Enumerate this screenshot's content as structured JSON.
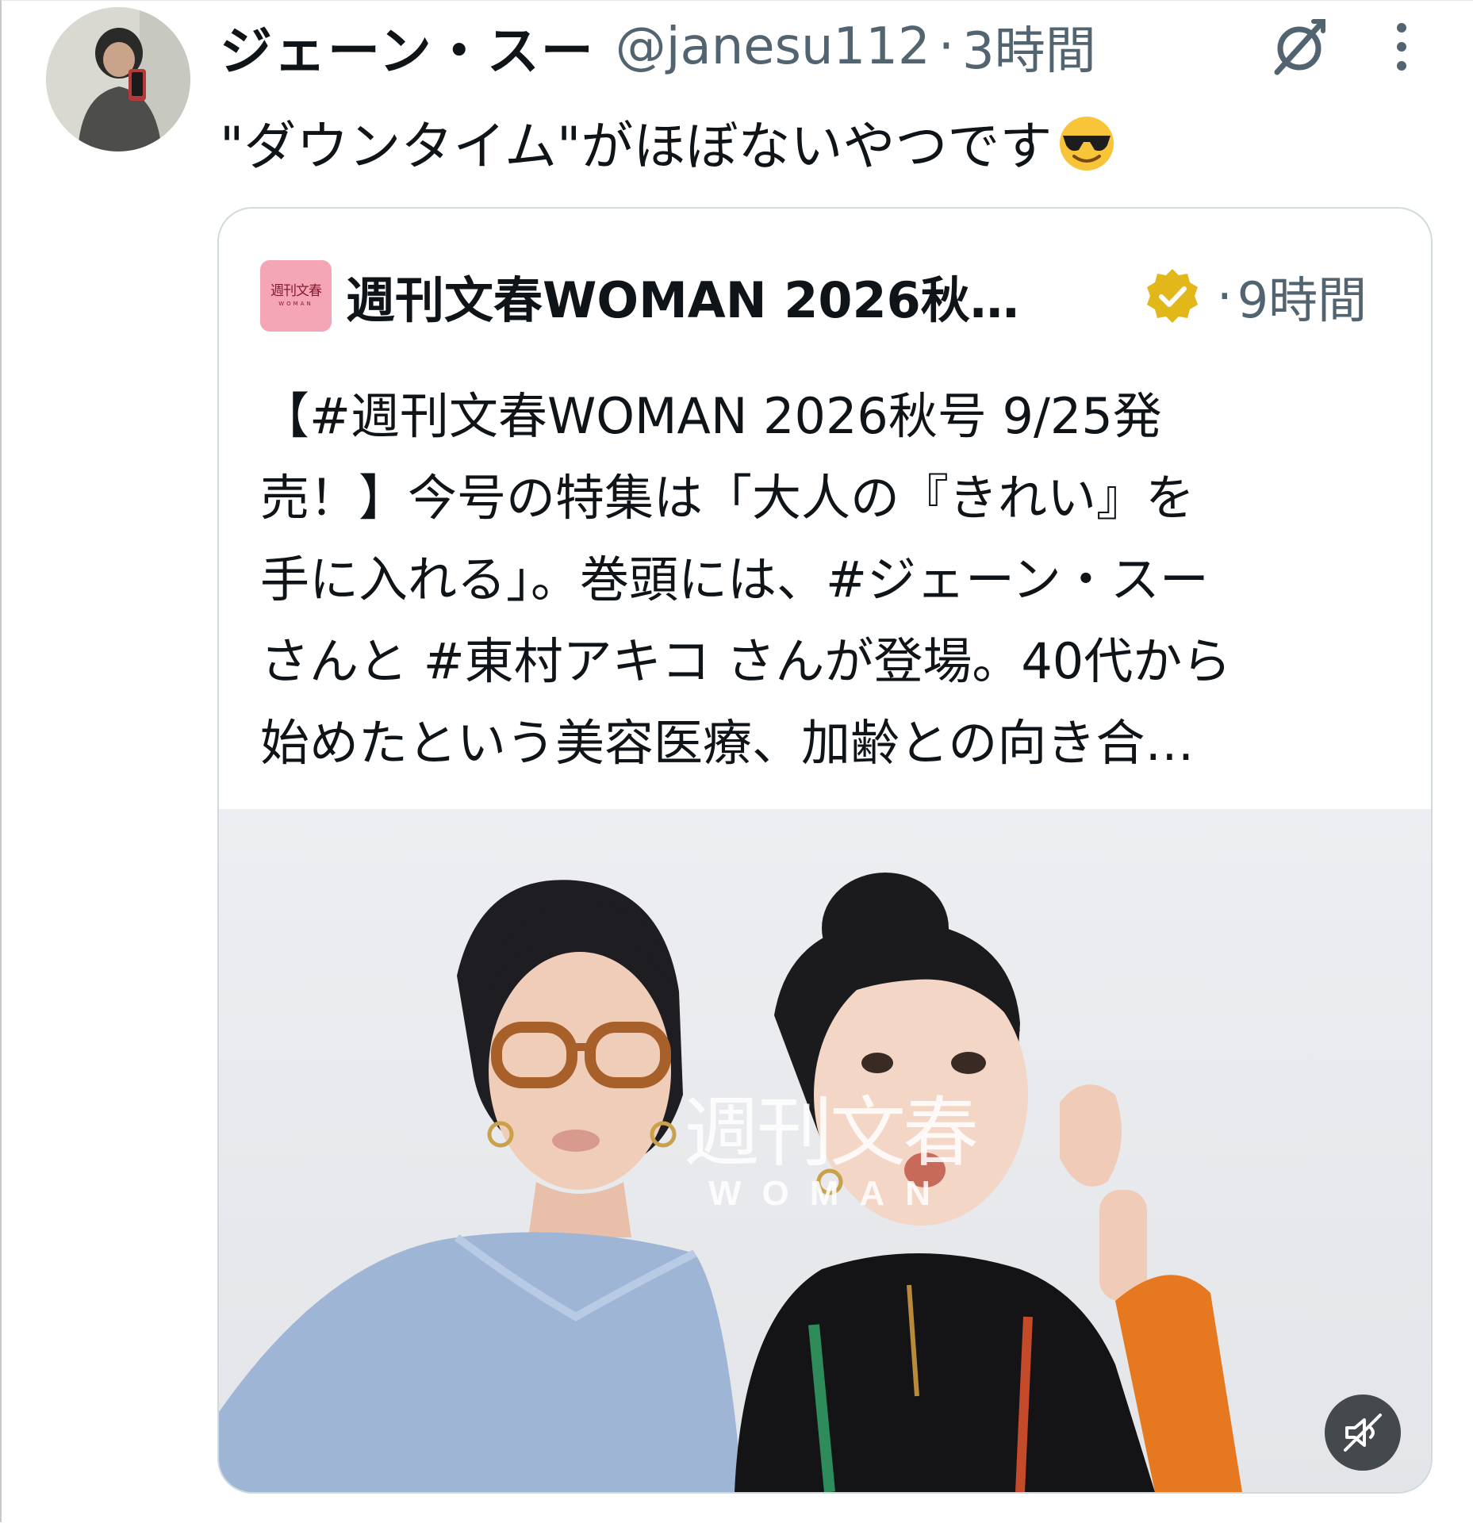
{
  "tweet": {
    "author_name": "ジェーン・スー",
    "handle": "@janesu112",
    "separator": "·",
    "time": "3時間",
    "text": "\"ダウンタイム\"がほぼないやつです",
    "emoji": "smiling-face-with-sunglasses"
  },
  "quote": {
    "account_name": "週刊文春WOMAN 2026秋…",
    "account_logo": "週刊文春",
    "account_logo_sub": "WOMAN",
    "separator": "·",
    "time": "9時間",
    "verified_color": "#e2b719",
    "body_lines": [
      "【#週刊文春WOMAN 2026秋号 9/25発",
      "売！】今号の特集は「大人の『きれい』を",
      "手に入れる」。巻頭には、#ジェーン・スー",
      "さんと #東村アキコ さんが登場。40代から",
      "始めたという美容医療、加齢との向き合…"
    ],
    "media": {
      "watermark_jp": "週刊文春",
      "watermark_en": "WOMAN",
      "mute_icon": "speaker-muted-icon"
    }
  },
  "icons": {
    "grok": "grok-icon",
    "more": "more-vertical-icon",
    "verified": "verified-badge-icon"
  },
  "colors": {
    "text_primary": "#0f1419",
    "text_secondary": "#536471",
    "card_border": "#cfd9de",
    "logo_bg": "#f4a5b6"
  }
}
